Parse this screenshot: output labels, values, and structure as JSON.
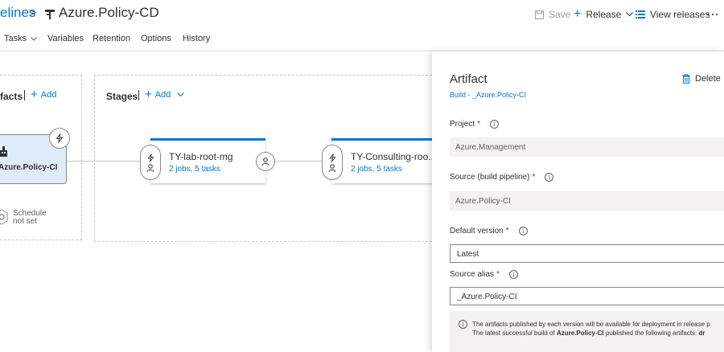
{
  "header": {
    "breadcrumb_parent": "elines",
    "breadcrumb_sep": ">",
    "pipeline_title": "Azure.Policy-CD",
    "save_label": "Save",
    "release_label": "Release",
    "view_releases_label": "View releases",
    "more_label": "⋯"
  },
  "tabs": [
    {
      "label": "Tasks"
    },
    {
      "label": "Variables"
    },
    {
      "label": "Retention"
    },
    {
      "label": "Options"
    },
    {
      "label": "History"
    }
  ],
  "artifacts": {
    "title": "facts",
    "add_label": "Add",
    "card_name": "Azure.Policy-CI",
    "schedule_line1": "Schedule",
    "schedule_line2": "not set"
  },
  "stages": {
    "title": "Stages",
    "add_label": "Add",
    "items": [
      {
        "name": "TY-lab-root-mg",
        "tasks": "2 jobs, 5 tasks"
      },
      {
        "name": "TY-Consulting-roo...",
        "tasks": "2 jobs, 5 tasks"
      }
    ]
  },
  "panel": {
    "title": "Artifact",
    "subtitle": "Build - _Azure.Policy-CI",
    "delete_label": "Delete",
    "project_label": "Project",
    "project_value": "Azure.Management",
    "source_label": "Source (build pipeline)",
    "source_value": "Azure.Policy-CI",
    "default_version_label": "Default version",
    "default_version_value": "Latest",
    "source_alias_label": "Source alias",
    "source_alias_value": "_Azure.Policy-CI",
    "required_mark": "*",
    "note_line1": "The artifacts published by each version will be available for deployment in release p",
    "note_line2_prefix": "The latest successful build of ",
    "note_line2_bold": "Azure.Policy-CI",
    "note_line2_suffix": " published the following artifacts: ",
    "note_line2_end": "dr"
  },
  "colors": {
    "accent": "#0078d4",
    "artifact_card_bg": "#deecf9",
    "required": "#a4262c"
  }
}
